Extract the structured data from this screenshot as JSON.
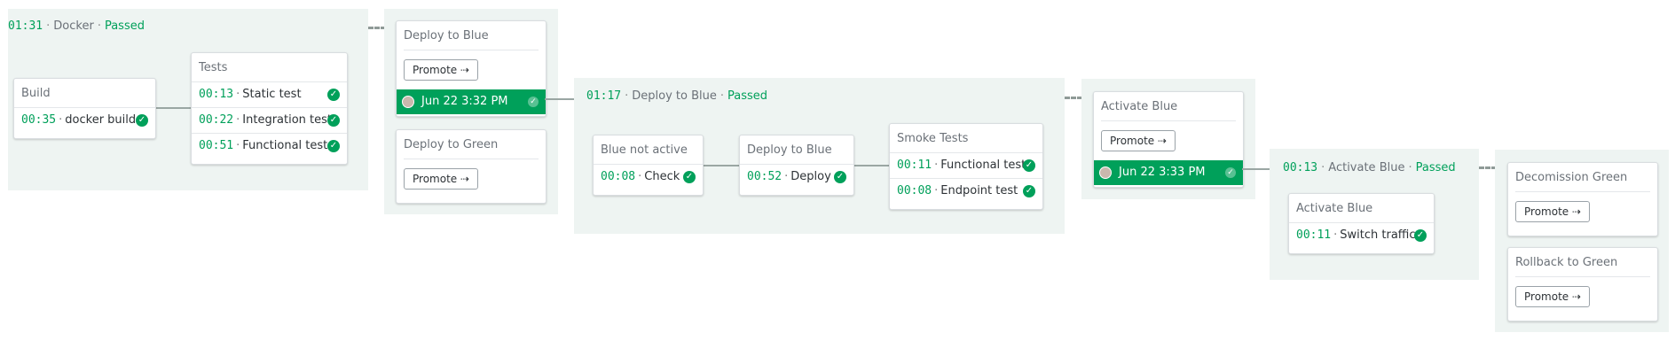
{
  "pipeline1": {
    "header": {
      "time": "01:31",
      "name": "Docker",
      "status": "Passed"
    },
    "build": {
      "title": "Build",
      "jobs": [
        {
          "time": "00:35",
          "name": "docker build"
        }
      ]
    },
    "tests": {
      "title": "Tests",
      "jobs": [
        {
          "time": "00:13",
          "name": "Static test"
        },
        {
          "time": "00:22",
          "name": "Integration test"
        },
        {
          "time": "00:51",
          "name": "Functional test"
        }
      ]
    }
  },
  "promotions1": {
    "deploy_blue": {
      "title": "Deploy to Blue",
      "promote": "Promote ⇢",
      "promoted": "Jun 22 3:32 PM"
    },
    "deploy_green": {
      "title": "Deploy to Green",
      "promote": "Promote ⇢"
    }
  },
  "pipeline2": {
    "header": {
      "time": "01:17",
      "name": "Deploy to Blue",
      "status": "Passed"
    },
    "blue_not_active": {
      "title": "Blue not active",
      "jobs": [
        {
          "time": "00:08",
          "name": "Check"
        }
      ]
    },
    "deploy_to_blue": {
      "title": "Deploy to Blue",
      "jobs": [
        {
          "time": "00:52",
          "name": "Deploy"
        }
      ]
    },
    "smoke": {
      "title": "Smoke Tests",
      "jobs": [
        {
          "time": "00:11",
          "name": "Functional test"
        },
        {
          "time": "00:08",
          "name": "Endpoint test"
        }
      ]
    }
  },
  "promotions2": {
    "activate_blue": {
      "title": "Activate Blue",
      "promote": "Promote ⇢",
      "promoted": "Jun 22 3:33 PM"
    }
  },
  "pipeline3": {
    "header": {
      "time": "00:13",
      "name": "Activate Blue",
      "status": "Passed"
    },
    "activate_blue": {
      "title": "Activate Blue",
      "jobs": [
        {
          "time": "00:11",
          "name": "Switch traffic"
        }
      ]
    }
  },
  "promotions3": {
    "decomission_green": {
      "title": "Decomission Green",
      "promote": "Promote ⇢"
    },
    "rollback_green": {
      "title": "Rollback to Green",
      "promote": "Promote ⇢"
    }
  },
  "colors": {
    "accent": "#00a05a",
    "panel": "#eef4f2"
  }
}
